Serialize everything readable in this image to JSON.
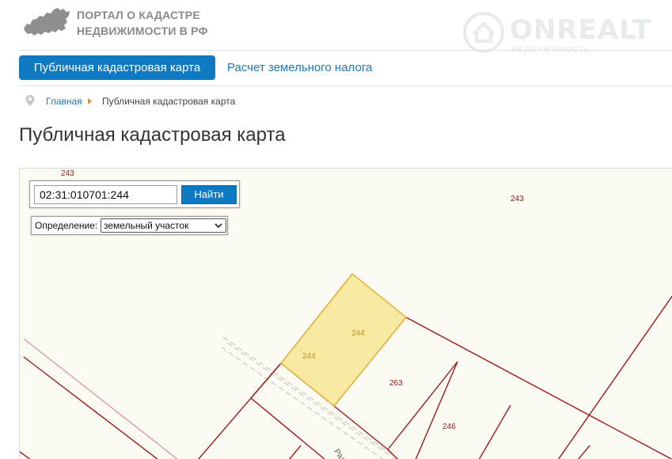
{
  "header": {
    "logo_line1": "ПОРТАЛ О КАДАСТРЕ",
    "logo_line2": "НЕДВИЖИМОСТИ В РФ",
    "watermark": "ONREALT",
    "watermark_sub": "НЕДВИЖИМОСТЬ"
  },
  "nav": {
    "tabs": [
      {
        "label": "Публичная кадастровая карта",
        "active": true
      },
      {
        "label": "Расчет земельного налога",
        "active": false
      }
    ]
  },
  "breadcrumb": {
    "home": "Главная",
    "current": "Публичная кадастровая карта"
  },
  "page_title": "Публичная кадастровая карта",
  "search": {
    "value": "02:31:010701:244",
    "button_label": "Найти"
  },
  "definition": {
    "label": "Определение:",
    "selected": "земельный участок"
  },
  "map": {
    "labels": {
      "top_left": "243",
      "top_right": "243",
      "highlight_a": "244",
      "highlight_b": "244",
      "parcel_263": "263",
      "parcel_246": "246",
      "street": "Радуж"
    },
    "colors": {
      "boundary": "#a01a1a",
      "highlight_fill": "#f9eaa3",
      "highlight_stroke": "#e2b542",
      "background": "#fbfbf3"
    }
  },
  "colors": {
    "accent": "#0f7ac2",
    "link": "#1a7bbf",
    "breadcrumb_arrow": "#f08a1c"
  }
}
